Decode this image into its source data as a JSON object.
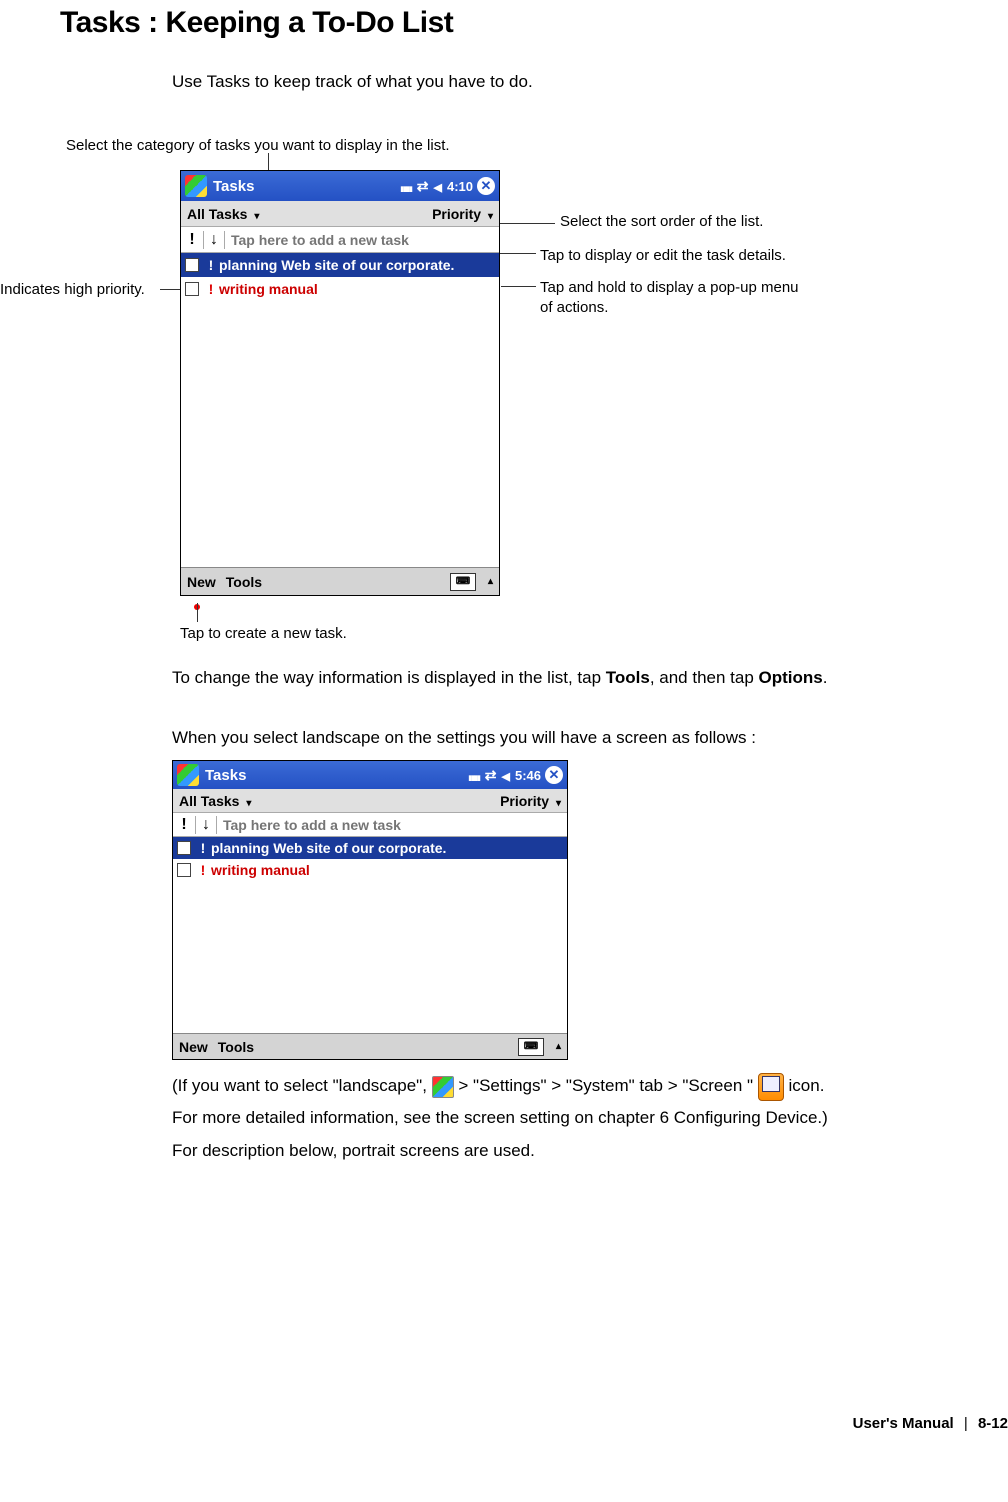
{
  "heading": "Tasks : Keeping a To-Do List",
  "intro": "Use Tasks to keep track of what you have to do.",
  "callouts": {
    "top": "Select the category of tasks you want to display in the list.",
    "left": "Indicates high priority.",
    "right1": "Select the sort order of the list.",
    "right2": "Tap to display or edit the task details.",
    "right3a": "Tap and hold to display a pop-up menu",
    "right3b": "of actions.",
    "bottom": "Tap to create a new task."
  },
  "shot1": {
    "title": "Tasks",
    "time": "4:10",
    "filter_left": "All Tasks",
    "filter_right": "Priority",
    "entry_placeholder": "Tap here to add a new task",
    "task1": "planning Web site of our corporate.",
    "task2": "writing manual",
    "menu_new": "New",
    "menu_tools": "Tools"
  },
  "para1_pre": "To change the way information is displayed in the list, tap ",
  "para1_b1": "Tools",
  "para1_mid": ", and then tap ",
  "para1_b2": "Options",
  "para1_post": ".",
  "para2": "When you select landscape on the settings you will have a screen as follows :",
  "shot2": {
    "title": "Tasks",
    "time": "5:46",
    "filter_left": "All Tasks",
    "filter_right": "Priority",
    "entry_placeholder": "Tap here to add a new task",
    "task1": "planning Web site of our corporate.",
    "task2": "writing manual",
    "menu_new": "New",
    "menu_tools": "Tools"
  },
  "para3": {
    "l1a": "(If you want to select \"landscape\", ",
    "l1b": " > \"Settings\" > \"System\" tab > \"Screen \"",
    "l1c": " icon.",
    "l2": "For more detailed information, see the screen setting on chapter 6 Configuring Device.)",
    "l3": "For description below, portrait screens are used."
  },
  "footer": {
    "label": "User's Manual",
    "page": "8-12"
  },
  "icons": {
    "priority_mark": "!",
    "sort_arrow": "↓",
    "close": "✕",
    "kbd_up": "▴",
    "dropdown": "▾"
  }
}
